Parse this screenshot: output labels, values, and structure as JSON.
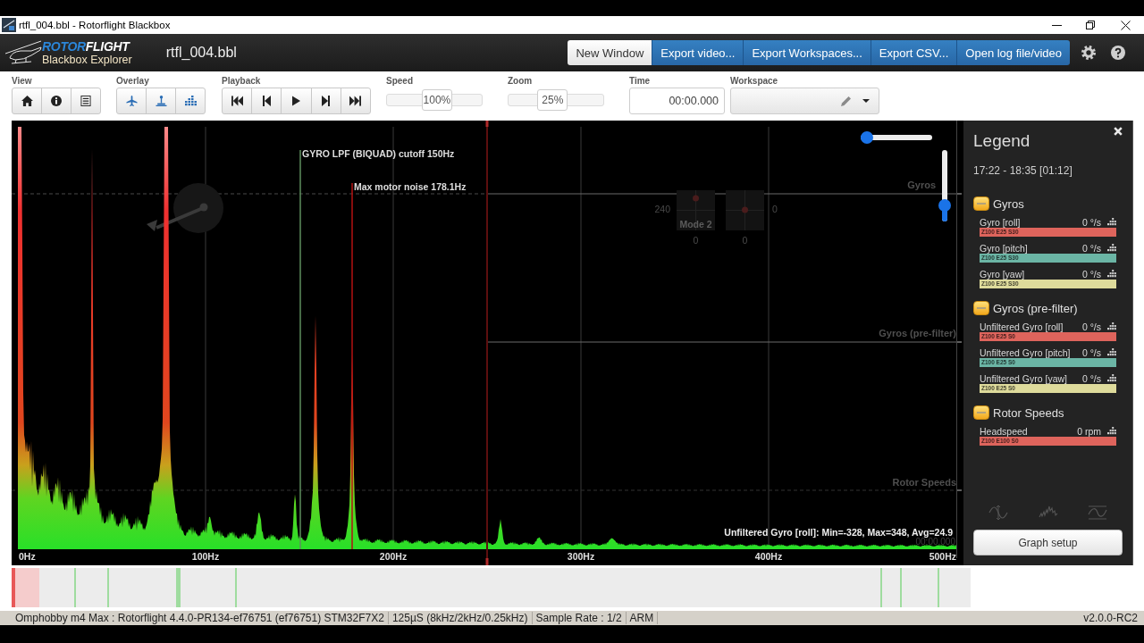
{
  "window": {
    "title": "rtfl_004.bbl - Rotorflight Blackbox"
  },
  "header": {
    "logo": {
      "wordmark_accent": "ROTOR",
      "wordmark_rest": "FLIGHT",
      "subtitle": "Blackbox Explorer"
    },
    "file_name": "rtfl_004.bbl",
    "buttons": [
      {
        "label": "New Window",
        "kind": "default"
      },
      {
        "label": "Export video...",
        "kind": "primary"
      },
      {
        "label": "Export Workspaces...",
        "kind": "primary"
      },
      {
        "label": "Export CSV...",
        "kind": "primary"
      },
      {
        "label": "Open log file/video",
        "kind": "primary"
      }
    ]
  },
  "toolbar": {
    "groups": [
      {
        "label": "View",
        "kind": "view"
      },
      {
        "label": "Overlay",
        "kind": "overlay"
      },
      {
        "label": "Playback",
        "kind": "playback"
      },
      {
        "label": "Speed",
        "kind": "slider",
        "value": "100%",
        "level": 0.54
      },
      {
        "label": "Zoom",
        "kind": "slider",
        "value": "25%",
        "level": 0.45
      },
      {
        "label": "Time",
        "kind": "time",
        "value": "00:00.000"
      },
      {
        "label": "Workspace",
        "kind": "workspace"
      }
    ]
  },
  "chart": {
    "x_axis_labels": [
      "0Hz",
      "100Hz",
      "200Hz",
      "300Hz",
      "400Hz",
      "500Hz"
    ],
    "annotations": [
      {
        "kind": "filter",
        "text": "GYRO LPF (BIQUAD) cutoff 150Hz"
      },
      {
        "kind": "motor_noise",
        "text": "Max motor noise 178.1Hz"
      }
    ],
    "graph_labels": [
      "Gyros",
      "Gyros (pre-filter)",
      "Rotor Speeds"
    ],
    "stick_overlay": {
      "mode": "Mode 2",
      "values": [
        "240",
        "0",
        "0",
        "0"
      ]
    },
    "overlay_time": "00:00.000",
    "stats": "Unfiltered Gyro [roll]: Min=-328, Max=348, Avg=24.9",
    "horizontal_slider": {
      "level": 0
    },
    "vertical_slider": {
      "level": 0.16
    }
  },
  "legend": {
    "title": "Legend",
    "time_range": "17:22 - 18:35 [01:12]",
    "groups": [
      {
        "name": "Gyros",
        "expanded": true,
        "rows": [
          {
            "name": "Gyro [roll]",
            "value": "0 °/s",
            "settings": "Z100 E25 S30",
            "color": "#de645c"
          },
          {
            "name": "Gyro [pitch]",
            "value": "0 °/s",
            "settings": "Z100 E25 S30",
            "color": "#6bb5a5"
          },
          {
            "name": "Gyro [yaw]",
            "value": "0 °/s",
            "settings": "Z100 E25 S30",
            "color": "#dedb9b"
          }
        ]
      },
      {
        "name": "Gyros (pre-filter)",
        "expanded": true,
        "rows": [
          {
            "name": "Unfiltered Gyro [roll]",
            "value": "0 °/s",
            "settings": "Z100 E25 S0",
            "color": "#de645c"
          },
          {
            "name": "Unfiltered Gyro [pitch]",
            "value": "0 °/s",
            "settings": "Z100 E25 S0",
            "color": "#6bb5a5"
          },
          {
            "name": "Unfiltered Gyro [yaw]",
            "value": "0 °/s",
            "settings": "Z100 E25 S0",
            "color": "#dedb9b"
          }
        ]
      },
      {
        "name": "Rotor Speeds",
        "expanded": true,
        "rows": [
          {
            "name": "Headspeed",
            "value": "0 rpm",
            "settings": "Z100 E100 S0",
            "color": "#de645c"
          }
        ]
      }
    ],
    "button": "Graph setup"
  },
  "status_bar": {
    "items": [
      "Omphobby m4 Max : Rotorflight 4.4.0-PR134-ef76751 (ef76751) STM32F7X2",
      "125µS (8kHz/2kHz/0.25kHz)",
      "Sample Rate : 1/2",
      "ARM"
    ],
    "version": "v2.0.0-RC2"
  }
}
